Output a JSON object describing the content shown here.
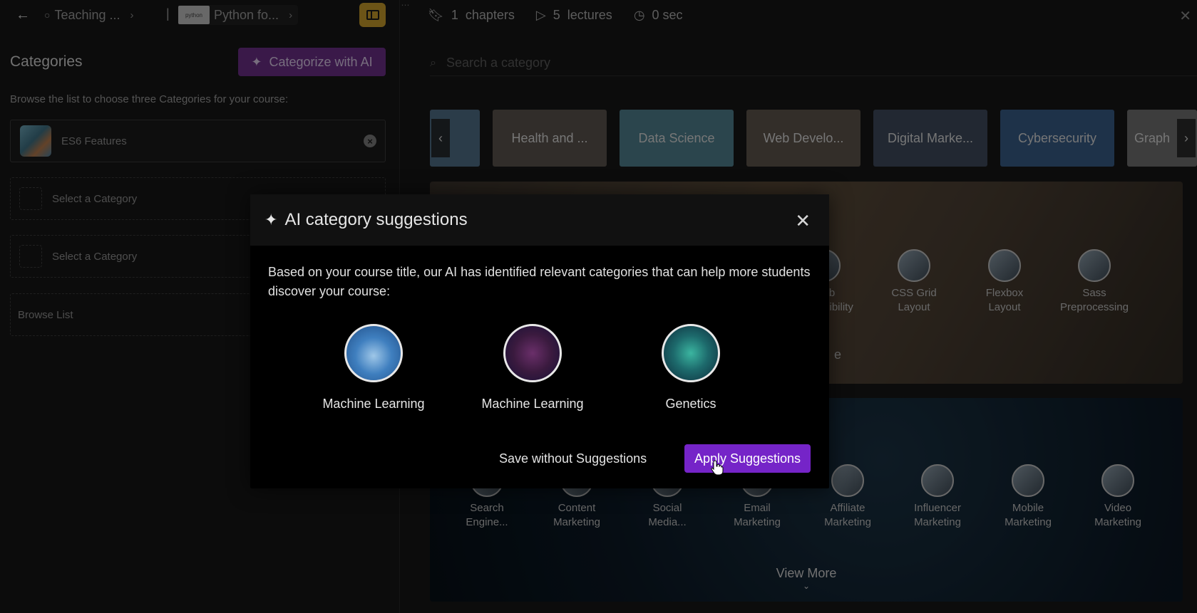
{
  "topbar": {
    "crumb1": "Teaching ...",
    "crumb_separator": "|",
    "crumb2": "Python fo...",
    "crumb2_thumb": "python"
  },
  "stats": {
    "chapters_count": "1",
    "chapters_label": "chapters",
    "lectures_count": "5",
    "lectures_label": "lectures",
    "duration": "0 sec"
  },
  "categories": {
    "title": "Categories",
    "ai_button": "Categorize with AI",
    "hint": "Browse the list to choose three Categories for your course:",
    "selected": "ES6 Features",
    "slot_placeholder": "Select a Category",
    "browse": "Browse List"
  },
  "search": {
    "placeholder": "Search a category"
  },
  "carousel": [
    {
      "label": "",
      "color": "#4f6e86"
    },
    {
      "label": "Health and ...",
      "color": "#5a534d"
    },
    {
      "label": "Data Science",
      "color": "#4f7f8d"
    },
    {
      "label": "Web Develo...",
      "color": "#5e554c"
    },
    {
      "label": "Digital Marke...",
      "color": "#3e4a5c"
    },
    {
      "label": "Cybersecurity",
      "color": "#375b86"
    },
    {
      "label": "Graph",
      "color": "#6f6f6f"
    }
  ],
  "block1_subs": [
    {
      "label": "Web\nAccessibility"
    },
    {
      "label": "CSS Grid\nLayout"
    },
    {
      "label": "Flexbox\nLayout"
    },
    {
      "label": "Sass\nPreprocessing"
    }
  ],
  "block1_partial": "e",
  "block2_subs": [
    {
      "label": "Search\nEngine..."
    },
    {
      "label": "Content\nMarketing"
    },
    {
      "label": "Social\nMedia..."
    },
    {
      "label": "Email\nMarketing"
    },
    {
      "label": "Affiliate\nMarketing"
    },
    {
      "label": "Influencer\nMarketing"
    },
    {
      "label": "Mobile\nMarketing"
    },
    {
      "label": "Video\nMarketing"
    }
  ],
  "view_more": "View More",
  "modal": {
    "title": "AI category suggestions",
    "description": "Based on your course title, our AI has identified relevant categories that can help more students discover your course:",
    "suggestions": [
      "Machine Learning",
      "Machine Learning",
      "Genetics"
    ],
    "save_button": "Save without Suggestions",
    "apply_button": "Apply Suggestions"
  },
  "colors": {
    "accent_purple": "#7524c8",
    "ai_button": "#6a2f86",
    "panel_toggle": "#c59a2a"
  }
}
